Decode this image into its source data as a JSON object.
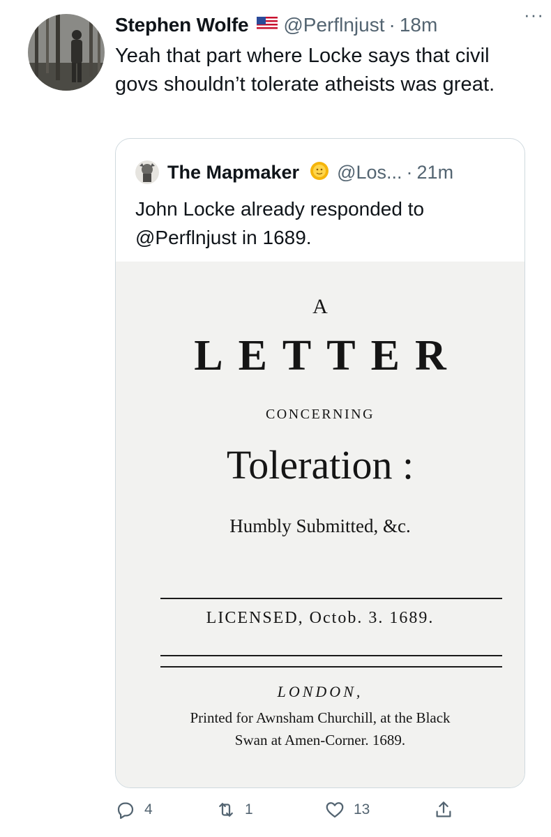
{
  "tweet": {
    "author_name": "Stephen Wolfe",
    "author_flag": "us-flag-icon",
    "handle": "@Perflnjust",
    "separator": "·",
    "time": "18m",
    "more": "···",
    "text": "Yeah that part where Locke says that civil govs shouldn’t tolerate atheists was great."
  },
  "quoted": {
    "author_name": "The Mapmaker",
    "emoji": "sun-face-icon",
    "handle": "@Los...",
    "separator": "·",
    "time": "21m",
    "text": "John Locke already responded to @Perflnjust in 1689.",
    "image_text": {
      "a": "A",
      "letter": "LETTER",
      "concerning": "CONCERNING",
      "toleration": "Toleration :",
      "humbly": "Humbly Submitted, &c.",
      "licensed": "LICENSED, Octob. 3. 1689.",
      "london": "LONDON,",
      "printed": "Printed for Awnsham Churchill, at the Black",
      "swan": "Swan at Amen-Corner. 1689."
    }
  },
  "actions": {
    "replies": "4",
    "retweets": "1",
    "likes": "13"
  },
  "colors": {
    "text": "#0f1419",
    "secondary": "#536471",
    "border": "#cfd9de"
  }
}
